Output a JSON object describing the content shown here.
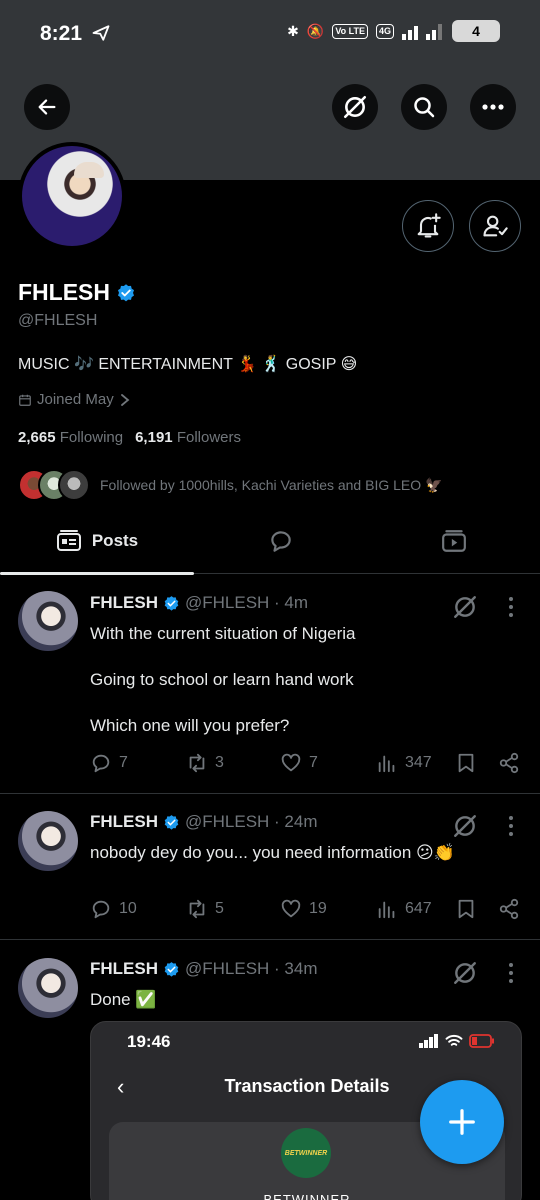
{
  "status_bar": {
    "time": "8:21",
    "network_badge_1": "Vo LTE",
    "network_badge_2": "4G",
    "battery": "4"
  },
  "header": {
    "back_icon": "arrow-left-icon",
    "grok_icon": "grok-icon",
    "search_icon": "search-icon",
    "more_icon": "more-horizontal-icon"
  },
  "profile": {
    "name": "FHLESH",
    "handle": "@FHLESH",
    "bio": "MUSIC 🎶 ENTERTAINMENT 💃 🕺 GOSIP 😅",
    "joined": "Joined May",
    "following_count": "2,665",
    "following_label": "Following",
    "followers_count": "6,191",
    "followers_label": "Followers",
    "followed_by": "Followed by 1000hills, Kachi Varieties and BIG LEO 🦅"
  },
  "tabs": {
    "posts_label": "Posts"
  },
  "posts": [
    {
      "name": "FHLESH",
      "meta": "@FHLESH · 4m",
      "text_lines": [
        "With the current situation of Nigeria",
        "Going to school or learn hand work",
        "Which one will you prefer?"
      ],
      "replies": "7",
      "reposts": "3",
      "likes": "7",
      "views": "347"
    },
    {
      "name": "FHLESH",
      "meta": "@FHLESH · 24m",
      "text_lines": [
        "nobody dey do you... you need information 😕👏"
      ],
      "replies": "10",
      "reposts": "5",
      "likes": "19",
      "views": "647"
    },
    {
      "name": "FHLESH",
      "meta": "@FHLESH · 34m",
      "text_lines": [
        "Done ✅"
      ],
      "embed": {
        "time": "19:46",
        "title": "Transaction Details",
        "logo_text": "BETWINNER",
        "card_text": "BETWINNER"
      }
    }
  ],
  "colors": {
    "accent": "#1d9bf0",
    "muted": "#71767b",
    "header_bg": "#333639"
  }
}
